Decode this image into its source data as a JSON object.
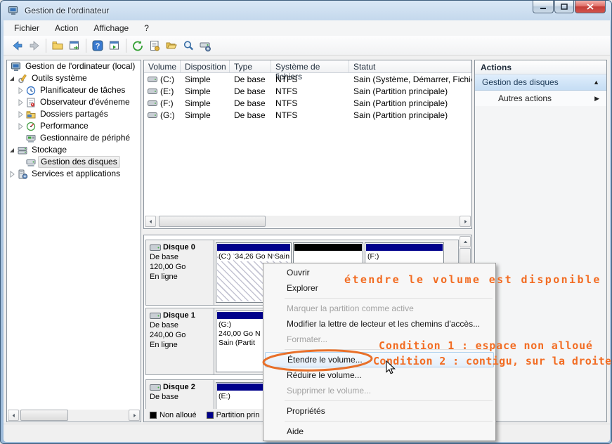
{
  "window": {
    "title": "Gestion de l'ordinateur"
  },
  "menu_bar": {
    "items": [
      "Fichier",
      "Action",
      "Affichage",
      "?"
    ]
  },
  "toolbar": {
    "icons": [
      "back-icon",
      "forward-icon",
      "console-tree-icon",
      "export-list-icon",
      "help-icon",
      "show-window-icon",
      "refresh-icon",
      "properties-icon",
      "open-folder-icon",
      "search-icon",
      "disk-manage-icon"
    ]
  },
  "tree": {
    "items": [
      {
        "label": "Gestion de l'ordinateur (local)",
        "icon": "computer-icon",
        "level": 0,
        "expander": "none",
        "selected": false
      },
      {
        "label": "Outils système",
        "icon": "tools-icon",
        "level": 1,
        "expander": "expanded",
        "selected": false
      },
      {
        "label": "Planificateur de tâches",
        "icon": "scheduler-icon",
        "level": 2,
        "expander": "collapsed",
        "selected": false
      },
      {
        "label": "Observateur d'événeme",
        "icon": "event-viewer-icon",
        "level": 2,
        "expander": "collapsed",
        "selected": false
      },
      {
        "label": "Dossiers partagés",
        "icon": "shared-folders-icon",
        "level": 2,
        "expander": "collapsed",
        "selected": false
      },
      {
        "label": "Performance",
        "icon": "performance-icon",
        "level": 2,
        "expander": "collapsed",
        "selected": false
      },
      {
        "label": "Gestionnaire de périphé",
        "icon": "device-manager-icon",
        "level": 2,
        "expander": "none",
        "selected": false
      },
      {
        "label": "Stockage",
        "icon": "storage-icon",
        "level": 1,
        "expander": "expanded",
        "selected": false
      },
      {
        "label": "Gestion des disques",
        "icon": "disk-management-icon",
        "level": 2,
        "expander": "none",
        "selected": true
      },
      {
        "label": "Services et applications",
        "icon": "services-icon",
        "level": 1,
        "expander": "collapsed",
        "selected": false
      }
    ]
  },
  "volume_table": {
    "columns": [
      "Volume",
      "Disposition",
      "Type",
      "Système de fichiers",
      "Statut"
    ],
    "rows": [
      [
        "(C:)",
        "Simple",
        "De base",
        "NTFS",
        "Sain (Système, Démarrer, Fichier"
      ],
      [
        "(E:)",
        "Simple",
        "De base",
        "NTFS",
        "Sain (Partition principale)"
      ],
      [
        "(F:)",
        "Simple",
        "De base",
        "NTFS",
        "Sain (Partition principale)"
      ],
      [
        "(G:)",
        "Simple",
        "De base",
        "NTFS",
        "Sain (Partition principale)"
      ]
    ]
  },
  "actions_panel": {
    "header": "Actions",
    "group_title": "Gestion des disques",
    "collapse_icon": "▲",
    "item": "Autres actions",
    "expand_icon": "▶"
  },
  "disk_pane": {
    "disks": [
      {
        "title": "Disque 0",
        "line1": "De base",
        "line2": "120,00 Go",
        "line3": "En ligne",
        "partitions": [
          {
            "label": "(C:)",
            "size_line": "34,26 Go N",
            "status_line": "Sain (Systè",
            "strip": "#00008b"
          },
          {
            "label": "",
            "strip": "#000000"
          },
          {
            "label": "(F:)",
            "strip": "#00008b"
          }
        ]
      },
      {
        "title": "Disque 1",
        "line1": "De base",
        "line2": "240,00 Go",
        "line3": "En ligne",
        "partitions": [
          {
            "label": "(G:)",
            "size_line": "240,00 Go N",
            "status_line": "Sain (Partit",
            "strip": "#00008b"
          }
        ]
      },
      {
        "title": "Disque 2",
        "line1": "De base",
        "line2": "",
        "line3": "",
        "partitions": [
          {
            "label": "(E:)",
            "strip": "#00008b"
          }
        ]
      }
    ],
    "legend": [
      {
        "label": "Non alloué",
        "color": "#000000"
      },
      {
        "label": "Partition prin",
        "color": "#00008b"
      }
    ]
  },
  "context_menu": {
    "items": [
      {
        "label": "Ouvrir",
        "state": "normal"
      },
      {
        "label": "Explorer",
        "state": "normal"
      },
      {
        "label": "Marquer la partition comme active",
        "state": "disabled"
      },
      {
        "label": "Modifier la lettre de lecteur et les chemins d'accès...",
        "state": "normal"
      },
      {
        "label": "Formater...",
        "state": "disabled"
      },
      {
        "label": "Étendre le volume...",
        "state": "highlighted"
      },
      {
        "label": "Réduire le volume...",
        "state": "normal"
      },
      {
        "label": "Supprimer le volume...",
        "state": "disabled"
      },
      {
        "label": "Propriétés",
        "state": "normal"
      },
      {
        "label": "Aide",
        "state": "normal"
      }
    ]
  },
  "annotations": {
    "note_available": "étendre le volume est disponible",
    "condition1": "Condition 1 : espace non alloué",
    "condition2": "Condition 2 : contigu, sur la droite",
    "color": "#f26c22"
  },
  "colors": {
    "partition_primary": "#00008b",
    "unallocated": "#000000",
    "annotation_orange": "#f26c22"
  }
}
